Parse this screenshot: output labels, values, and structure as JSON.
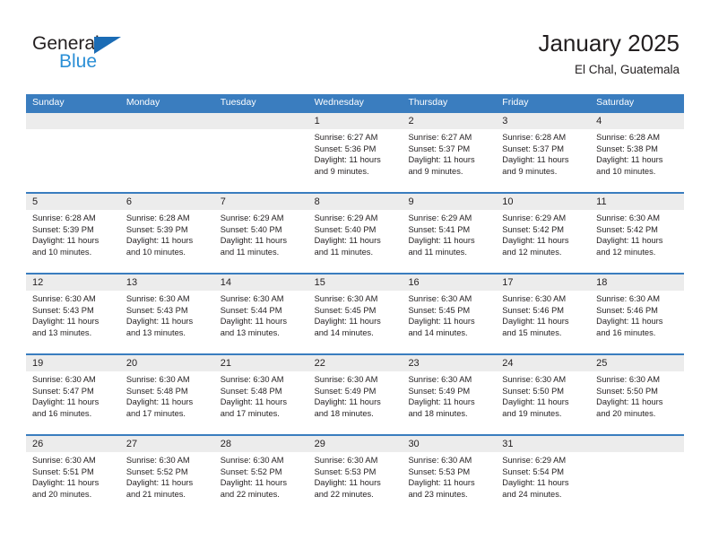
{
  "logo": {
    "word_one": "General",
    "word_two": "Blue",
    "triangle_color": "#1b6cb5",
    "blue_color": "#2b8fd6"
  },
  "header": {
    "title": "January 2025",
    "subtitle": "El Chal, Guatemala"
  },
  "theme": {
    "header_bar": "#3a7dbf",
    "daynum_band": "#ececec",
    "text": "#231f20"
  },
  "calendar": {
    "weekdays": [
      "Sunday",
      "Monday",
      "Tuesday",
      "Wednesday",
      "Thursday",
      "Friday",
      "Saturday"
    ],
    "weeks": [
      [
        {
          "day": "",
          "sunrise": "",
          "sunset": "",
          "daylight": ""
        },
        {
          "day": "",
          "sunrise": "",
          "sunset": "",
          "daylight": ""
        },
        {
          "day": "",
          "sunrise": "",
          "sunset": "",
          "daylight": ""
        },
        {
          "day": "1",
          "sunrise": "Sunrise: 6:27 AM",
          "sunset": "Sunset: 5:36 PM",
          "daylight": "Daylight: 11 hours and 9 minutes."
        },
        {
          "day": "2",
          "sunrise": "Sunrise: 6:27 AM",
          "sunset": "Sunset: 5:37 PM",
          "daylight": "Daylight: 11 hours and 9 minutes."
        },
        {
          "day": "3",
          "sunrise": "Sunrise: 6:28 AM",
          "sunset": "Sunset: 5:37 PM",
          "daylight": "Daylight: 11 hours and 9 minutes."
        },
        {
          "day": "4",
          "sunrise": "Sunrise: 6:28 AM",
          "sunset": "Sunset: 5:38 PM",
          "daylight": "Daylight: 11 hours and 10 minutes."
        }
      ],
      [
        {
          "day": "5",
          "sunrise": "Sunrise: 6:28 AM",
          "sunset": "Sunset: 5:39 PM",
          "daylight": "Daylight: 11 hours and 10 minutes."
        },
        {
          "day": "6",
          "sunrise": "Sunrise: 6:28 AM",
          "sunset": "Sunset: 5:39 PM",
          "daylight": "Daylight: 11 hours and 10 minutes."
        },
        {
          "day": "7",
          "sunrise": "Sunrise: 6:29 AM",
          "sunset": "Sunset: 5:40 PM",
          "daylight": "Daylight: 11 hours and 11 minutes."
        },
        {
          "day": "8",
          "sunrise": "Sunrise: 6:29 AM",
          "sunset": "Sunset: 5:40 PM",
          "daylight": "Daylight: 11 hours and 11 minutes."
        },
        {
          "day": "9",
          "sunrise": "Sunrise: 6:29 AM",
          "sunset": "Sunset: 5:41 PM",
          "daylight": "Daylight: 11 hours and 11 minutes."
        },
        {
          "day": "10",
          "sunrise": "Sunrise: 6:29 AM",
          "sunset": "Sunset: 5:42 PM",
          "daylight": "Daylight: 11 hours and 12 minutes."
        },
        {
          "day": "11",
          "sunrise": "Sunrise: 6:30 AM",
          "sunset": "Sunset: 5:42 PM",
          "daylight": "Daylight: 11 hours and 12 minutes."
        }
      ],
      [
        {
          "day": "12",
          "sunrise": "Sunrise: 6:30 AM",
          "sunset": "Sunset: 5:43 PM",
          "daylight": "Daylight: 11 hours and 13 minutes."
        },
        {
          "day": "13",
          "sunrise": "Sunrise: 6:30 AM",
          "sunset": "Sunset: 5:43 PM",
          "daylight": "Daylight: 11 hours and 13 minutes."
        },
        {
          "day": "14",
          "sunrise": "Sunrise: 6:30 AM",
          "sunset": "Sunset: 5:44 PM",
          "daylight": "Daylight: 11 hours and 13 minutes."
        },
        {
          "day": "15",
          "sunrise": "Sunrise: 6:30 AM",
          "sunset": "Sunset: 5:45 PM",
          "daylight": "Daylight: 11 hours and 14 minutes."
        },
        {
          "day": "16",
          "sunrise": "Sunrise: 6:30 AM",
          "sunset": "Sunset: 5:45 PM",
          "daylight": "Daylight: 11 hours and 14 minutes."
        },
        {
          "day": "17",
          "sunrise": "Sunrise: 6:30 AM",
          "sunset": "Sunset: 5:46 PM",
          "daylight": "Daylight: 11 hours and 15 minutes."
        },
        {
          "day": "18",
          "sunrise": "Sunrise: 6:30 AM",
          "sunset": "Sunset: 5:46 PM",
          "daylight": "Daylight: 11 hours and 16 minutes."
        }
      ],
      [
        {
          "day": "19",
          "sunrise": "Sunrise: 6:30 AM",
          "sunset": "Sunset: 5:47 PM",
          "daylight": "Daylight: 11 hours and 16 minutes."
        },
        {
          "day": "20",
          "sunrise": "Sunrise: 6:30 AM",
          "sunset": "Sunset: 5:48 PM",
          "daylight": "Daylight: 11 hours and 17 minutes."
        },
        {
          "day": "21",
          "sunrise": "Sunrise: 6:30 AM",
          "sunset": "Sunset: 5:48 PM",
          "daylight": "Daylight: 11 hours and 17 minutes."
        },
        {
          "day": "22",
          "sunrise": "Sunrise: 6:30 AM",
          "sunset": "Sunset: 5:49 PM",
          "daylight": "Daylight: 11 hours and 18 minutes."
        },
        {
          "day": "23",
          "sunrise": "Sunrise: 6:30 AM",
          "sunset": "Sunset: 5:49 PM",
          "daylight": "Daylight: 11 hours and 18 minutes."
        },
        {
          "day": "24",
          "sunrise": "Sunrise: 6:30 AM",
          "sunset": "Sunset: 5:50 PM",
          "daylight": "Daylight: 11 hours and 19 minutes."
        },
        {
          "day": "25",
          "sunrise": "Sunrise: 6:30 AM",
          "sunset": "Sunset: 5:50 PM",
          "daylight": "Daylight: 11 hours and 20 minutes."
        }
      ],
      [
        {
          "day": "26",
          "sunrise": "Sunrise: 6:30 AM",
          "sunset": "Sunset: 5:51 PM",
          "daylight": "Daylight: 11 hours and 20 minutes."
        },
        {
          "day": "27",
          "sunrise": "Sunrise: 6:30 AM",
          "sunset": "Sunset: 5:52 PM",
          "daylight": "Daylight: 11 hours and 21 minutes."
        },
        {
          "day": "28",
          "sunrise": "Sunrise: 6:30 AM",
          "sunset": "Sunset: 5:52 PM",
          "daylight": "Daylight: 11 hours and 22 minutes."
        },
        {
          "day": "29",
          "sunrise": "Sunrise: 6:30 AM",
          "sunset": "Sunset: 5:53 PM",
          "daylight": "Daylight: 11 hours and 22 minutes."
        },
        {
          "day": "30",
          "sunrise": "Sunrise: 6:30 AM",
          "sunset": "Sunset: 5:53 PM",
          "daylight": "Daylight: 11 hours and 23 minutes."
        },
        {
          "day": "31",
          "sunrise": "Sunrise: 6:29 AM",
          "sunset": "Sunset: 5:54 PM",
          "daylight": "Daylight: 11 hours and 24 minutes."
        },
        {
          "day": "",
          "sunrise": "",
          "sunset": "",
          "daylight": ""
        }
      ]
    ]
  }
}
